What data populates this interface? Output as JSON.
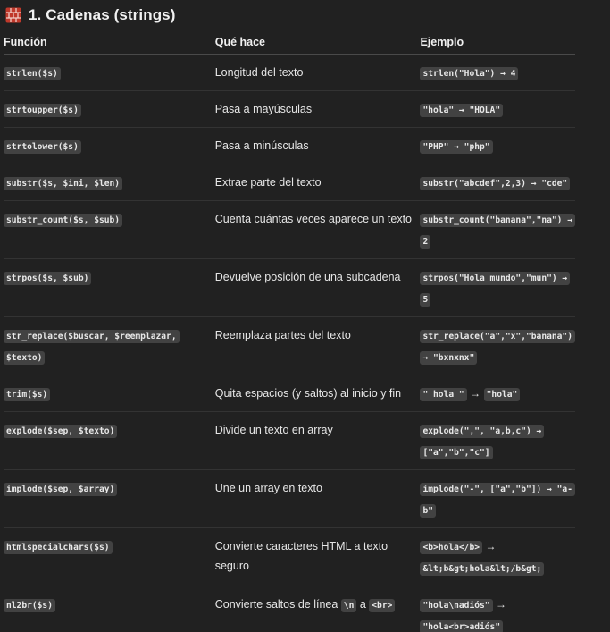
{
  "heading": {
    "icon": "brick-icon",
    "title": "1. Cadenas (strings)"
  },
  "table": {
    "headers": [
      "Función",
      "Qué hace",
      "Ejemplo"
    ],
    "rows": [
      {
        "func": "strlen($s)",
        "desc": "Longitud del texto",
        "example": "strlen(\"Hola\") → 4"
      },
      {
        "func": "strtoupper($s)",
        "desc": "Pasa a mayúsculas",
        "example": "\"hola\" → \"HOLA\""
      },
      {
        "func": "strtolower($s)",
        "desc": "Pasa a minúsculas",
        "example": "\"PHP\" → \"php\""
      },
      {
        "func": "substr($s, $ini, $len)",
        "desc": "Extrae parte del texto",
        "example": "substr(\"abcdef\",2,3) → \"cde\""
      },
      {
        "func": "substr_count($s, $sub)",
        "desc": "Cuenta cuántas veces aparece un texto",
        "example": "substr_count(\"banana\",\"na\") → 2"
      },
      {
        "func": "strpos($s, $sub)",
        "desc": "Devuelve posición de una subcadena",
        "example": "strpos(\"Hola mundo\",\"mun\") → 5"
      },
      {
        "func": "str_replace($buscar, $reemplazar, $texto)",
        "desc": "Reemplaza partes del texto",
        "example": "str_replace(\"a\",\"x\",\"banana\") → \"bxnxnx\""
      },
      {
        "func": "trim($s)",
        "desc": "Quita espacios (y saltos) al inicio y fin",
        "example_a": "\" hola \"",
        "arrow": "→",
        "example_b": "\"hola\""
      },
      {
        "func": "explode($sep, $texto)",
        "desc": "Divide un texto en array",
        "example": "explode(\",\", \"a,b,c\") → [\"a\",\"b\",\"c\"]"
      },
      {
        "func": "implode($sep, $array)",
        "desc": "Une un array en texto",
        "example": "implode(\"-\", [\"a\",\"b\"]) → \"a-b\""
      },
      {
        "func": "htmlspecialchars($s)",
        "desc": "Convierte caracteres HTML a texto seguro",
        "example_a": "<b>hola</b>",
        "arrow": "→",
        "example_b": "&lt;b&gt;hola&lt;/b&gt;"
      },
      {
        "func": "nl2br($s)",
        "desc_a": "Convierte saltos de línea",
        "desc_code1": "\\n",
        "desc_mid": "a",
        "desc_code2": "<br>",
        "example_a": "\"hola\\nadiós\"",
        "arrow": "→",
        "example_b": "\"hola<br>adiós\""
      }
    ]
  }
}
